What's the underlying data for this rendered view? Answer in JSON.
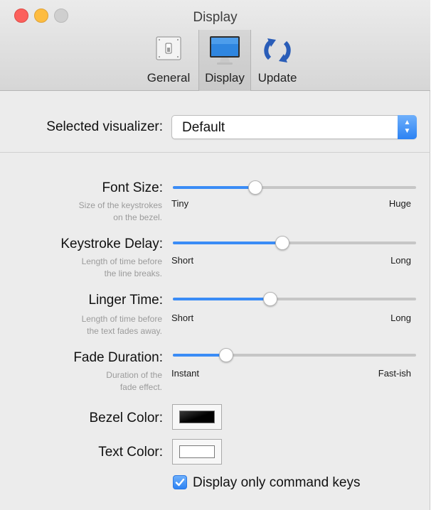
{
  "window": {
    "title": "Display"
  },
  "toolbar": {
    "items": [
      {
        "label": "General",
        "icon": "general-switch-icon",
        "selected": false
      },
      {
        "label": "Display",
        "icon": "monitor-icon",
        "selected": true
      },
      {
        "label": "Update",
        "icon": "refresh-icon",
        "selected": false
      }
    ]
  },
  "visualizer": {
    "label": "Selected visualizer:",
    "value": "Default"
  },
  "sliders": [
    {
      "label": "Font Size:",
      "desc": [
        "Size of the keystrokes",
        "on the bezel."
      ],
      "min_label": "Tiny",
      "max_label": "Huge",
      "value": 0.34
    },
    {
      "label": "Keystroke Delay:",
      "desc": [
        "Length of time before",
        "the line breaks."
      ],
      "min_label": "Short",
      "max_label": "Long",
      "value": 0.45
    },
    {
      "label": "Linger Time:",
      "desc": [
        "Length of time before",
        "the text fades away."
      ],
      "min_label": "Short",
      "max_label": "Long",
      "value": 0.4
    },
    {
      "label": "Fade Duration:",
      "desc": [
        "Duration of the",
        "fade effect."
      ],
      "min_label": "Instant",
      "max_label": "Fast-ish",
      "value": 0.22
    }
  ],
  "colors": {
    "bezel": {
      "label": "Bezel Color:",
      "value": "#000000"
    },
    "text": {
      "label": "Text Color:",
      "value": "#ffffff"
    }
  },
  "options": {
    "display_only_command_keys": {
      "label": "Display only command keys",
      "checked": true
    }
  },
  "accent_color": "#3a8cf6"
}
